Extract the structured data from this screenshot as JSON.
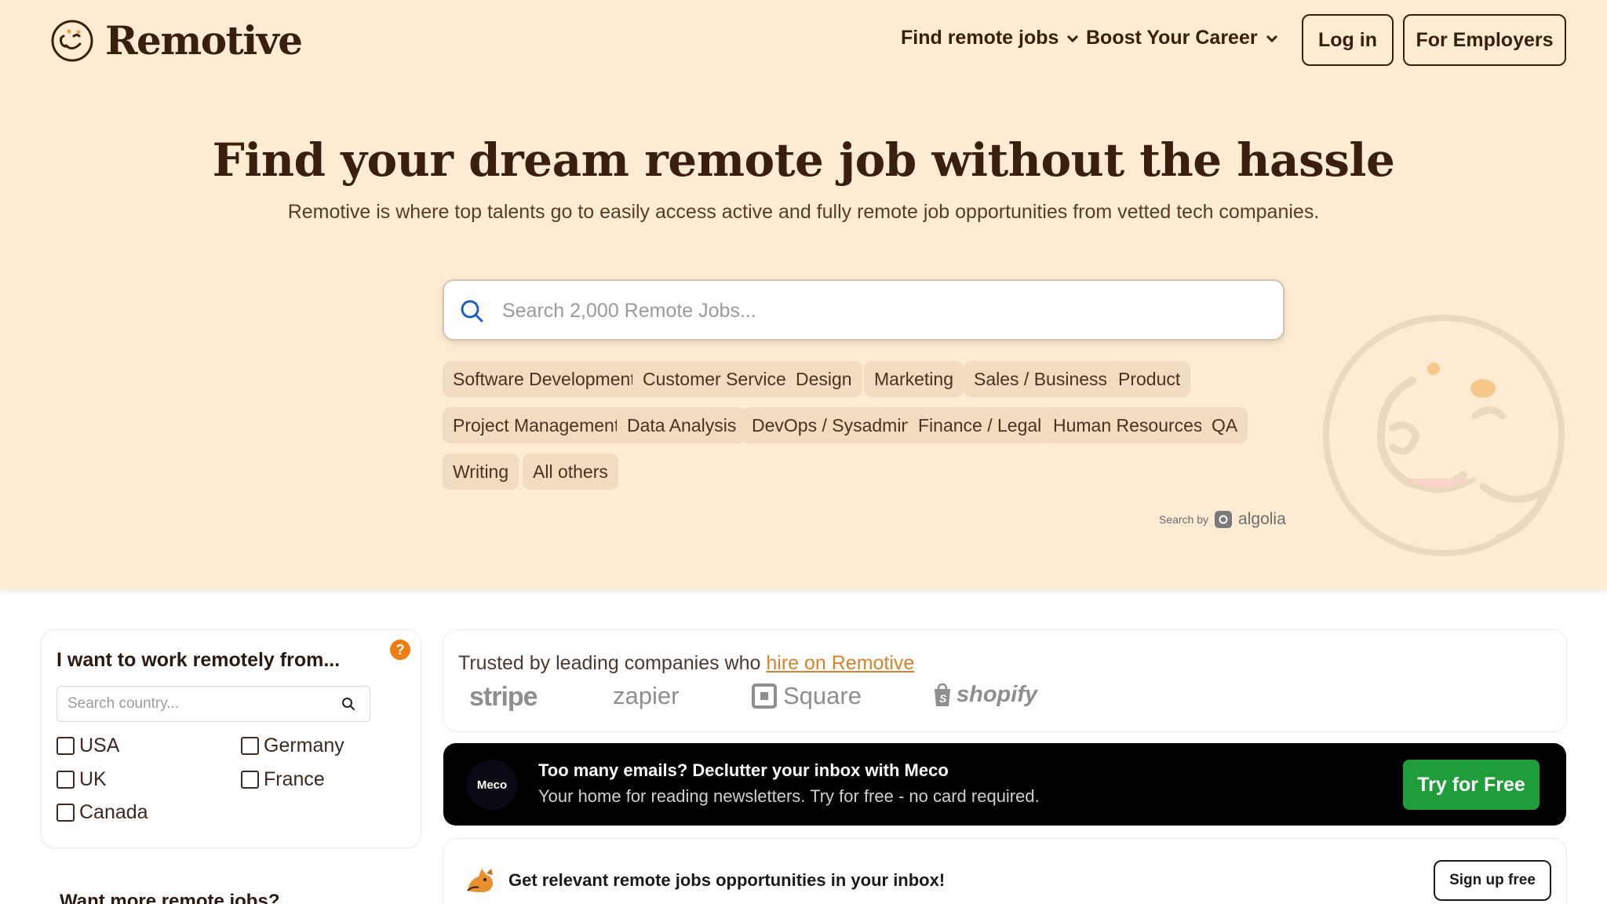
{
  "header": {
    "brand": "Remotive",
    "nav": [
      {
        "label": "Find remote jobs",
        "icon": "chevron-down-icon"
      },
      {
        "label": "Boost Your Career",
        "icon": "chevron-down-icon"
      }
    ],
    "login_label": "Log in",
    "employers_label": "For Employers"
  },
  "hero": {
    "title": "Find your dream remote job without the hassle",
    "subtitle": "Remotive is where top talents go to easily access active and fully remote job opportunities from vetted tech companies.",
    "search_placeholder": "Search 2,000 Remote Jobs...",
    "categories": [
      "Software Development",
      "Customer Service",
      "Design",
      "Marketing",
      "Sales / Business",
      "Product",
      "Project Management",
      "Data Analysis",
      "DevOps / Sysadmin",
      "Finance / Legal",
      "Human Resources",
      "QA",
      "Writing",
      "All others"
    ],
    "search_by": "Search by",
    "search_provider": "algolia"
  },
  "filter": {
    "title": "I want to work remotely from...",
    "help": "?",
    "search_placeholder": "Search country...",
    "countries": [
      {
        "label": "USA",
        "checked": false
      },
      {
        "label": "Germany",
        "checked": false
      },
      {
        "label": "UK",
        "checked": false
      },
      {
        "label": "France",
        "checked": false
      },
      {
        "label": "Canada",
        "checked": false
      }
    ]
  },
  "more": {
    "title": "Want more remote jobs?"
  },
  "trusted": {
    "text": "Trusted by leading companies who ",
    "link": "hire on Remotive",
    "companies": [
      "stripe",
      "zapier",
      "Square",
      "shopify"
    ]
  },
  "ad": {
    "logo": "Meco",
    "headline": "Too many emails? Declutter your inbox with Meco",
    "subtext": "Your home for reading newsletters. Try for free - no card required.",
    "cta": "Try for Free"
  },
  "newsletter": {
    "text": "Get relevant remote jobs opportunities in your inbox!",
    "cta": "Sign up free"
  },
  "colors": {
    "hero_bg": "#feebd3",
    "brand_dark": "#3b1f0e",
    "chip_bg": "#f2dcc1",
    "accent_orange": "#d9822b",
    "cta_green": "#1f9d3a"
  }
}
